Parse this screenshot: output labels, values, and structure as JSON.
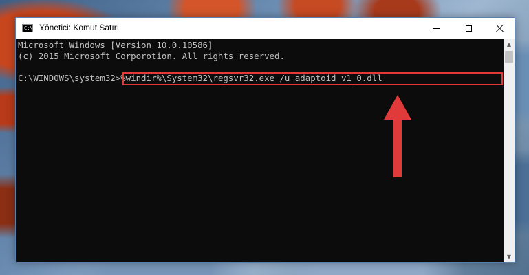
{
  "window": {
    "title": "Yönetici: Komut Satırı",
    "icon": "cmd-icon",
    "icon_prompt": "C:\\"
  },
  "controls": {
    "minimize_icon": "minimize-icon",
    "maximize_icon": "maximize-icon",
    "close_icon": "close-icon"
  },
  "console": {
    "line1": "Microsoft Windows [Version 10.0.10586]",
    "line2": "(c) 2015 Microsoft Corporotion. All rights reserved.",
    "prompt": "C:\\WINDOWS\\system32>",
    "command": "%windir%\\System32\\regsvr32.exe /u adaptoid_v1_0.dll"
  },
  "annotation": {
    "highlight_color": "#e03a3a",
    "arrow_icon": "up-arrow-icon"
  },
  "colors": {
    "console_bg": "#0c0c0c",
    "console_text": "#c0c0c0"
  }
}
